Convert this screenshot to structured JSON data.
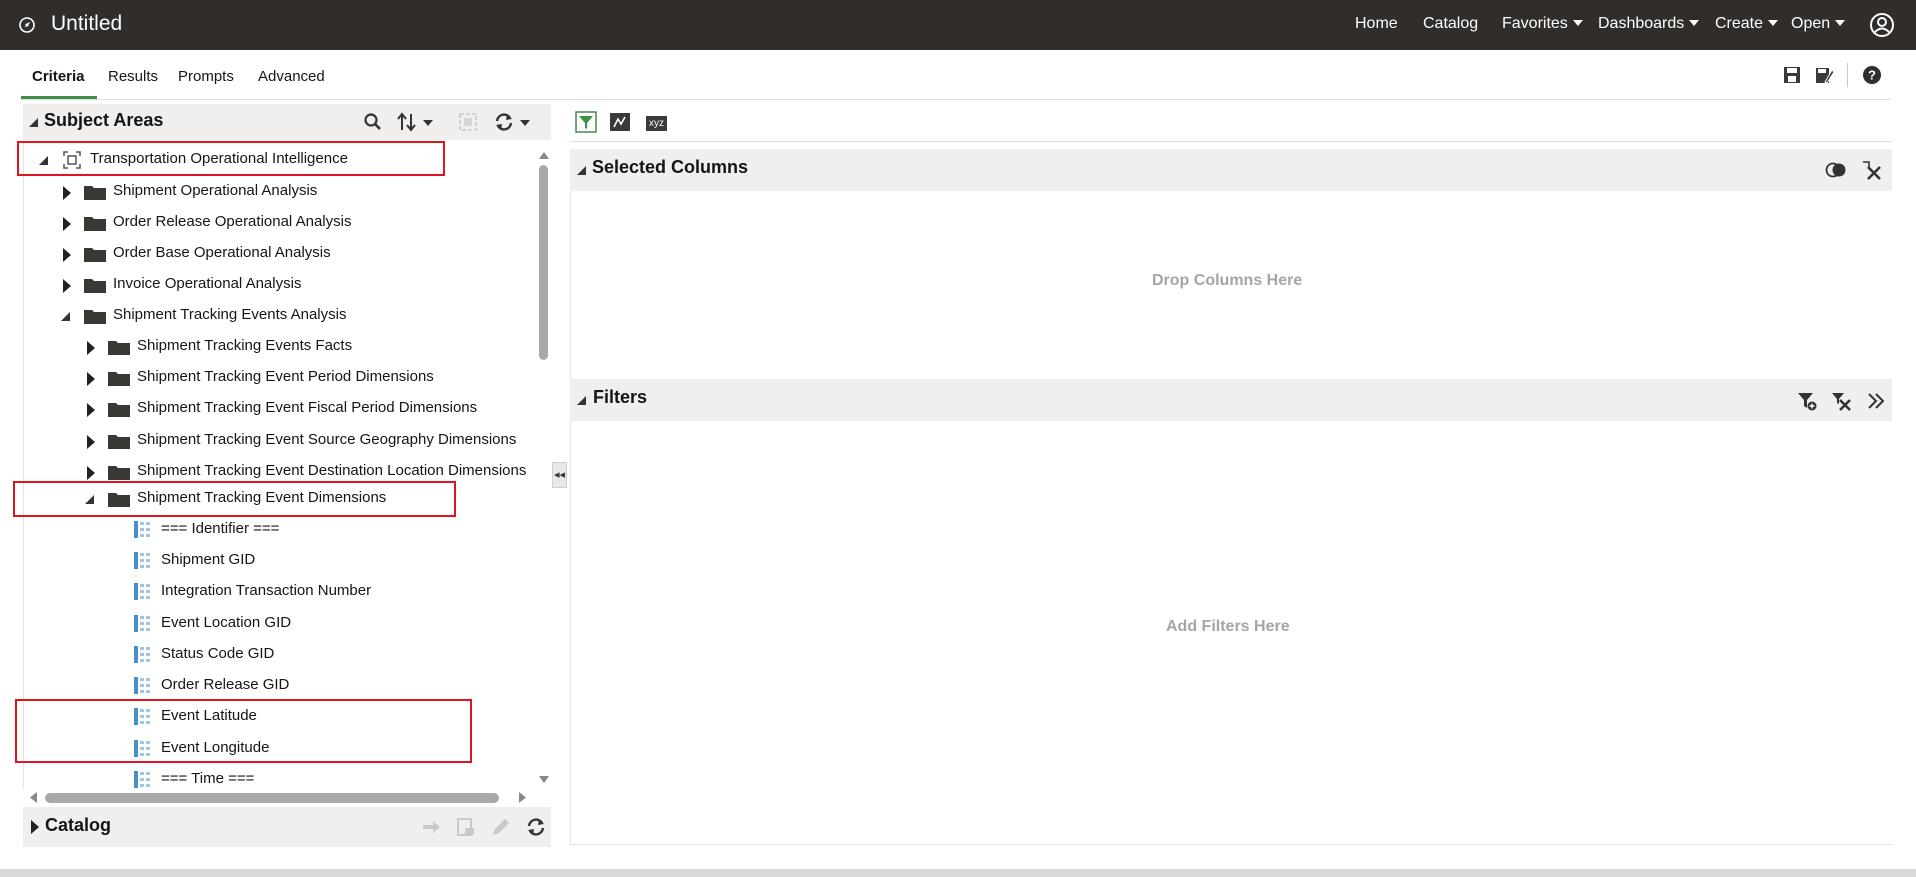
{
  "header": {
    "title": "Untitled",
    "nav": [
      "Home",
      "Catalog",
      "Favorites",
      "Dashboards",
      "Create",
      "Open"
    ]
  },
  "tabs": [
    "Criteria",
    "Results",
    "Prompts",
    "Advanced"
  ],
  "subject_areas": {
    "title": "Subject Areas",
    "root": "Transportation Operational Intelligence",
    "folders": [
      "Shipment Operational Analysis",
      "Order Release Operational Analysis",
      "Order Base Operational Analysis",
      "Invoice Operational Analysis",
      "Shipment Tracking Events Analysis"
    ],
    "subfolders": [
      "Shipment Tracking Events Facts",
      "Shipment Tracking Event Period Dimensions",
      "Shipment Tracking Event Fiscal Period Dimensions",
      "Shipment Tracking Event Source Geography Dimensions",
      "Shipment Tracking Event Destination Location Dimensions",
      "Shipment Tracking Event Dimensions"
    ],
    "columns": [
      "=== Identifier ===",
      "Shipment GID",
      "Integration Transaction Number",
      "Event Location GID",
      "Status Code GID",
      "Order Release GID",
      "Event Latitude",
      "Event Longitude",
      "=== Time ==="
    ]
  },
  "catalog": {
    "title": "Catalog"
  },
  "selected_columns": {
    "title": "Selected Columns",
    "placeholder": "Drop Columns Here"
  },
  "filters": {
    "title": "Filters",
    "placeholder": "Add Filters Here"
  },
  "toolbar": {
    "xyz_label": "xyz"
  },
  "colors": {
    "header_bg": "#312d2a",
    "accent_green": "#3f8d48",
    "highlight_red": "#e0141e"
  }
}
